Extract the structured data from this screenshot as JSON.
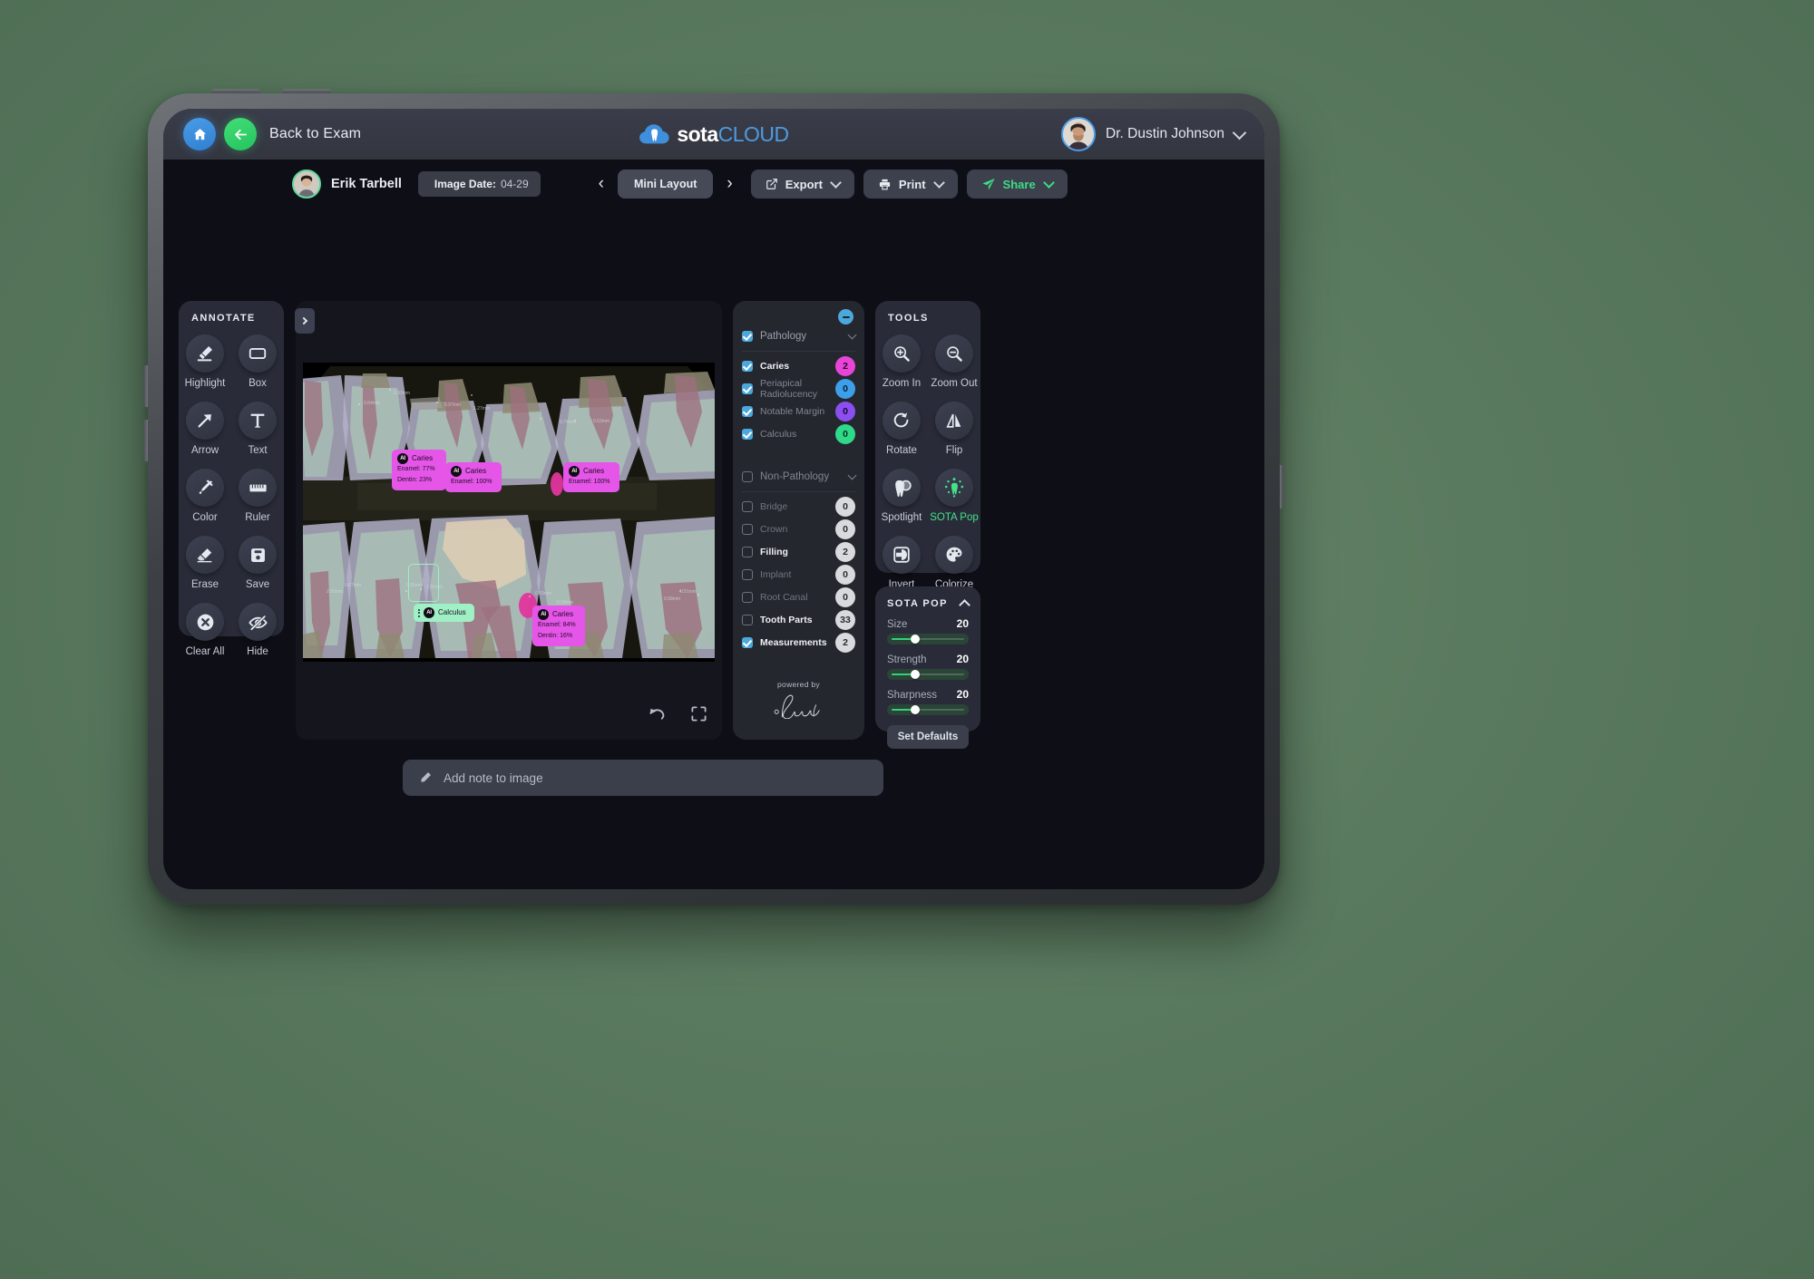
{
  "app": {
    "logo_primary": "sota",
    "logo_secondary": "CLOUD",
    "logo_icon": "cloud-tooth-icon"
  },
  "topbar": {
    "home_icon": "home-icon",
    "back_icon": "back-arrow-icon",
    "back_label": "Back to Exam",
    "user_name": "Dr. Dustin Johnson",
    "user_chevron": "chevron-down-icon"
  },
  "subbar": {
    "patient_name": "Erik Tarbell",
    "image_date_label": "Image Date:",
    "image_date_value": "04-29",
    "prev_icon": "chevron-left-icon",
    "next_icon": "chevron-right-icon",
    "layout_label": "Mini Layout",
    "export_label": "Export",
    "export_icon": "external-link-icon",
    "print_label": "Print",
    "print_icon": "printer-icon",
    "share_label": "Share",
    "share_icon": "paper-plane-icon"
  },
  "annotate": {
    "title": "ANNOTATE",
    "tools": [
      {
        "label": "Highlight",
        "icon": "highlighter-pen-icon"
      },
      {
        "label": "Box",
        "icon": "rectangle-icon"
      },
      {
        "label": "Arrow",
        "icon": "arrow-up-right-icon"
      },
      {
        "label": "Text",
        "icon": "text-t-icon"
      },
      {
        "label": "Color",
        "icon": "eyedropper-icon"
      },
      {
        "label": "Ruler",
        "icon": "ruler-icon"
      },
      {
        "label": "Erase",
        "icon": "eraser-icon"
      },
      {
        "label": "Save",
        "icon": "floppy-disk-icon"
      },
      {
        "label": "Clear All",
        "icon": "x-circle-icon"
      },
      {
        "label": "Hide",
        "icon": "eye-slash-icon"
      }
    ]
  },
  "findings": {
    "collapse_icon": "minus-circle-icon",
    "groups": [
      {
        "name": "Pathology",
        "checked": true,
        "items": [
          {
            "label": "Caries",
            "count": "2",
            "color": "#e845d8",
            "checked": true,
            "active": true
          },
          {
            "label": "Periapical Radiolucency",
            "count": "0",
            "color": "#3e9ee8",
            "checked": true,
            "active": false
          },
          {
            "label": "Notable Margin",
            "count": "0",
            "color": "#8b4ff0",
            "checked": true,
            "active": false
          },
          {
            "label": "Calculus",
            "count": "0",
            "color": "#2fd98a",
            "checked": true,
            "active": false
          }
        ]
      },
      {
        "name": "Non-Pathology",
        "checked": false,
        "items": [
          {
            "label": "Bridge",
            "count": "0",
            "color": "#d8dade",
            "checked": false,
            "active": false
          },
          {
            "label": "Crown",
            "count": "0",
            "color": "#d8dade",
            "checked": false,
            "active": false
          },
          {
            "label": "Filling",
            "count": "2",
            "color": "#d8dade",
            "checked": false,
            "active": true
          },
          {
            "label": "Implant",
            "count": "0",
            "color": "#d8dade",
            "checked": false,
            "active": false
          },
          {
            "label": "Root Canal",
            "count": "0",
            "color": "#d8dade",
            "checked": false,
            "active": false
          },
          {
            "label": "Tooth Parts",
            "count": "33",
            "color": "#d8dade",
            "checked": false,
            "active": true
          },
          {
            "label": "Measurements",
            "count": "2",
            "color": "#d8dade",
            "checked": true,
            "active": true
          }
        ]
      }
    ],
    "powered_by": "powered by",
    "powered_brand": "Pearl"
  },
  "tools": {
    "title": "TOOLS",
    "items": [
      {
        "label": "Zoom In",
        "icon": "magnifier-plus-icon",
        "active": false
      },
      {
        "label": "Zoom Out",
        "icon": "magnifier-minus-icon",
        "active": false
      },
      {
        "label": "Rotate",
        "icon": "rotate-cw-icon",
        "active": false
      },
      {
        "label": "Flip",
        "icon": "flip-horizontal-icon",
        "active": false
      },
      {
        "label": "Spotlight",
        "icon": "tooth-spotlight-icon",
        "active": false
      },
      {
        "label": "SOTA Pop",
        "icon": "sparkle-tooth-icon",
        "active": true
      },
      {
        "label": "Invert",
        "icon": "contrast-invert-icon",
        "active": false
      },
      {
        "label": "Colorize",
        "icon": "palette-icon",
        "active": false
      }
    ]
  },
  "sotapop": {
    "title": "SOTA POP",
    "collapse_icon": "chevron-up-icon",
    "sliders": [
      {
        "label": "Size",
        "value": "20"
      },
      {
        "label": "Strength",
        "value": "20"
      },
      {
        "label": "Sharpness",
        "value": "20"
      }
    ],
    "defaults_label": "Set Defaults"
  },
  "viewer": {
    "expand_tab_icon": "chevron-right-icon",
    "undo_icon": "undo-arrow-icon",
    "fullscreen_icon": "fullscreen-icon",
    "annotations": [
      {
        "type": "caries",
        "badge": "AI",
        "title": "Caries",
        "lines": [
          "Enamel: 77%",
          "Dentin: 23%"
        ]
      },
      {
        "type": "caries",
        "badge": "AI",
        "title": "Caries",
        "lines": [
          "Enamel: 100%"
        ]
      },
      {
        "type": "caries",
        "badge": "AI",
        "title": "Caries",
        "lines": [
          "Enamel: 100%"
        ]
      },
      {
        "type": "caries",
        "badge": "AI",
        "title": "Caries",
        "lines": [
          "Enamel: 84%",
          "Dentin: 16%"
        ]
      },
      {
        "type": "calculus",
        "badge": "AI",
        "title": "Calculus",
        "lines": []
      }
    ],
    "measurements": [
      "0.64mm",
      "0.93mm",
      "0.97mm",
      "1.27mm",
      "0.74mm",
      "0.63mm",
      "2.00mm",
      "0.67mm",
      "0.95mm",
      "1.32mm",
      "0.83mm",
      "0.93mm",
      "0.51mm",
      "0.58mm"
    ]
  },
  "note": {
    "icon": "pencil-icon",
    "placeholder": "Add note to image"
  }
}
